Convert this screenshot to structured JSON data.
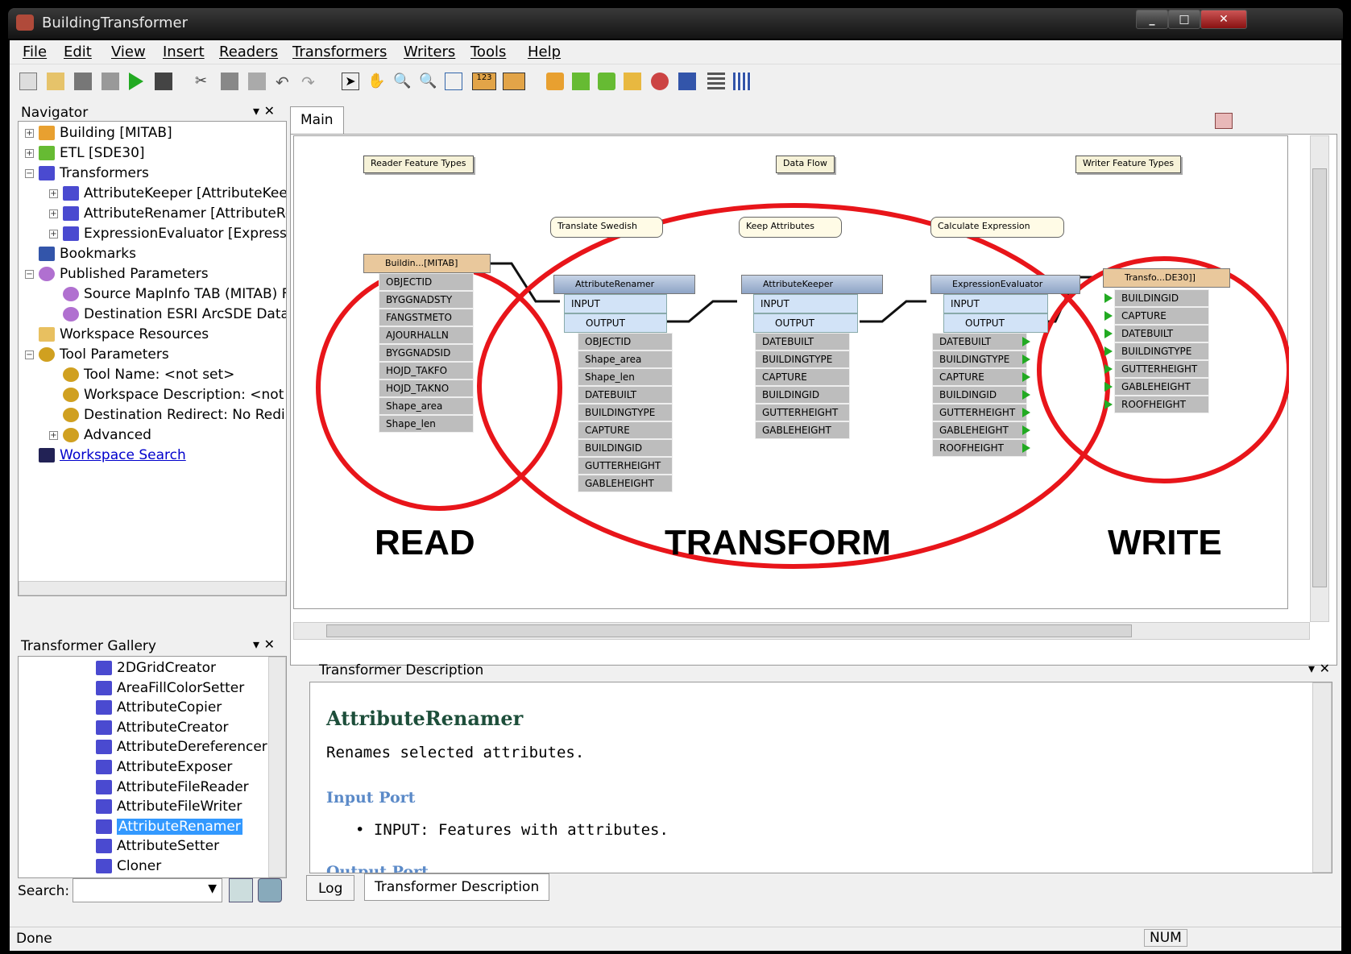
{
  "window": {
    "title": "BuildingTransformer"
  },
  "menu": [
    "File",
    "Edit",
    "View",
    "Insert",
    "Readers",
    "Transformers",
    "Writers",
    "Tools",
    "Help"
  ],
  "navigator": {
    "title": "Navigator",
    "items": [
      {
        "label": "Building [MITAB]"
      },
      {
        "label": "ETL [SDE30]"
      },
      {
        "label": "Transformers"
      },
      {
        "label": "AttributeKeeper [AttributeKeep"
      },
      {
        "label": "AttributeRenamer [AttributeRe"
      },
      {
        "label": "ExpressionEvaluator [Expressic"
      },
      {
        "label": "Bookmarks"
      },
      {
        "label": "Published Parameters"
      },
      {
        "label": "Source MapInfo TAB (MITAB) F"
      },
      {
        "label": "Destination ESRI ArcSDE Datas"
      },
      {
        "label": "Workspace Resources"
      },
      {
        "label": "Tool Parameters"
      },
      {
        "label": "Tool Name: <not set>"
      },
      {
        "label": "Workspace Description: <not s"
      },
      {
        "label": "Destination Redirect: No Redire"
      },
      {
        "label": "Advanced"
      },
      {
        "label": "Workspace Search"
      }
    ]
  },
  "gallery": {
    "title": "Transformer Gallery",
    "items": [
      "2DGridCreator",
      "AreaFillColorSetter",
      "AttributeCopier",
      "AttributeCreator",
      "AttributeDereferencer",
      "AttributeExposer",
      "AttributeFileReader",
      "AttributeFileWriter",
      "AttributeRenamer",
      "AttributeSetter",
      "Cloner"
    ],
    "search_label": "Search:"
  },
  "canvas": {
    "tab": "Main",
    "notes": {
      "reader": "Reader Feature Types",
      "flow": "Data Flow",
      "writer": "Writer Feature Types"
    },
    "callouts": {
      "c1": "Translate Swedish",
      "c2": "Keep Attributes",
      "c3": "Calculate Expression"
    },
    "reader": {
      "name": "Buildin...[MITAB]",
      "attrs": [
        "OBJECTID",
        "BYGGNADSTY",
        "FANGSTMETO",
        "AJOURHALLN",
        "BYGGNADSID",
        "HOJD_TAKFO",
        "HOJD_TAKNO",
        "Shape_area",
        "Shape_len"
      ]
    },
    "renamer": {
      "name": "AttributeRenamer",
      "attrs": [
        "OBJECTID",
        "Shape_area",
        "Shape_len",
        "DATEBUILT",
        "BUILDINGTYPE",
        "CAPTURE",
        "BUILDINGID",
        "GUTTERHEIGHT",
        "GABLEHEIGHT"
      ]
    },
    "keeper": {
      "name": "AttributeKeeper",
      "attrs": [
        "DATEBUILT",
        "BUILDINGTYPE",
        "CAPTURE",
        "BUILDINGID",
        "GUTTERHEIGHT",
        "GABLEHEIGHT"
      ]
    },
    "evaluator": {
      "name": "ExpressionEvaluator",
      "attrs": [
        "DATEBUILT",
        "BUILDINGTYPE",
        "CAPTURE",
        "BUILDINGID",
        "GUTTERHEIGHT",
        "GABLEHEIGHT",
        "ROOFHEIGHT"
      ]
    },
    "writer": {
      "name": "Transfo...DE30]]",
      "attrs": [
        "BUILDINGID",
        "CAPTURE",
        "DATEBUILT",
        "BUILDINGTYPE",
        "GUTTERHEIGHT",
        "GABLEHEIGHT",
        "ROOFHEIGHT"
      ]
    },
    "ports": {
      "input": "INPUT",
      "output": "OUTPUT"
    },
    "labels": {
      "read": "READ",
      "transform": "TRANSFORM",
      "write": "WRITE"
    }
  },
  "description": {
    "panel_title": "Transformer Description",
    "heading": "AttributeRenamer",
    "summary": "Renames selected attributes.",
    "input_heading": "Input Port",
    "input_item": "INPUT: Features with attributes.",
    "output_heading": "Output Port",
    "tabs": [
      "Log",
      "Transformer Description"
    ]
  },
  "status": {
    "text": "Done",
    "num": "NUM"
  }
}
